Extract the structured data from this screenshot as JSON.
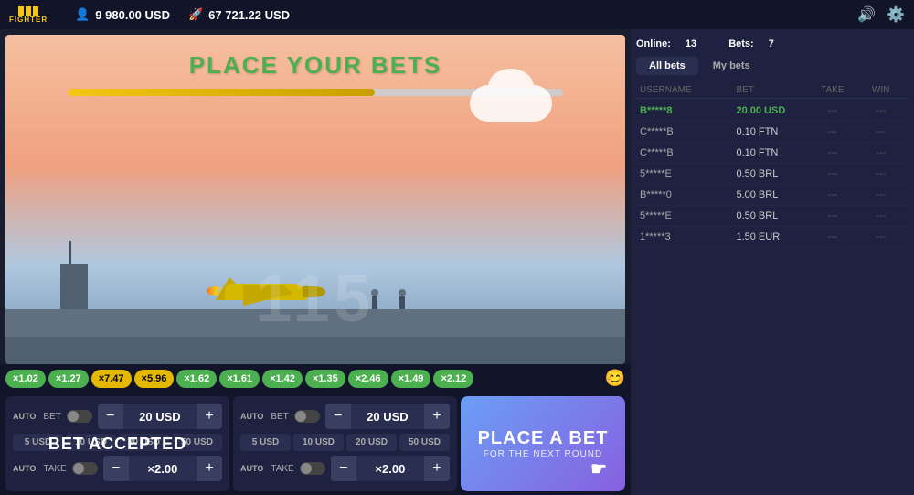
{
  "header": {
    "logo_bars": "///",
    "logo_text": "FIGHTER",
    "balance1_icon": "👤",
    "balance1": "9 980.00 USD",
    "balance2_icon": "🚀",
    "balance2": "67 721.22 USD",
    "icon_sound": "🔊",
    "icon_settings": "⚙️"
  },
  "game": {
    "title": "PLACE YOUR BETS",
    "progress_pct": 62,
    "round_number": "115"
  },
  "multipliers": [
    {
      "label": "×1.02",
      "color": "green"
    },
    {
      "label": "×1.27",
      "color": "green"
    },
    {
      "label": "×7.47",
      "color": "yellow"
    },
    {
      "label": "×5.96",
      "color": "yellow"
    },
    {
      "label": "×1.62",
      "color": "green"
    },
    {
      "label": "×1.61",
      "color": "green"
    },
    {
      "label": "×1.42",
      "color": "green"
    },
    {
      "label": "×1.35",
      "color": "green"
    },
    {
      "label": "×2.46",
      "color": "green"
    },
    {
      "label": "×1.49",
      "color": "green"
    },
    {
      "label": "×2.12",
      "color": "green"
    }
  ],
  "bet_panel_left": {
    "auto_label": "AUTO",
    "bet_label": "BET",
    "amount": "20 USD",
    "minus": "−",
    "plus": "+",
    "quick": [
      "5 USD",
      "10 USD",
      "20 USD",
      "50 USD"
    ],
    "take_label": "TAKE",
    "take_value": "×2.00",
    "status": "BET ACCEPTED"
  },
  "bet_panel_right": {
    "auto_label": "AUTO",
    "bet_label": "BET",
    "amount": "20 USD",
    "minus": "−",
    "plus": "+",
    "quick": [
      "5 USD",
      "10 USD",
      "20 USD",
      "50 USD"
    ],
    "take_label": "TAKE",
    "take_value": "×2.00"
  },
  "place_bet_btn": {
    "main": "PLACE A BET",
    "sub": "FOR THE NEXT ROUND"
  },
  "bets_panel": {
    "online_label": "Online:",
    "online_count": "13",
    "bets_label": "Bets:",
    "bets_count": "7",
    "tab_all": "All bets",
    "tab_my": "My bets",
    "columns": [
      "USERNAME",
      "BET",
      "TAKE",
      "WIN"
    ],
    "rows": [
      {
        "user": "B*****8",
        "bet": "20.00 USD",
        "take": "---",
        "win": "---",
        "highlight": true
      },
      {
        "user": "C*****B",
        "bet": "0.10 FTN",
        "take": "---",
        "win": "---",
        "highlight": false
      },
      {
        "user": "C*****B",
        "bet": "0.10 FTN",
        "take": "---",
        "win": "---",
        "highlight": false
      },
      {
        "user": "5*****E",
        "bet": "0.50 BRL",
        "take": "---",
        "win": "---",
        "highlight": false
      },
      {
        "user": "B*****0",
        "bet": "5.00 BRL",
        "take": "---",
        "win": "---",
        "highlight": false
      },
      {
        "user": "5*****E",
        "bet": "0.50 BRL",
        "take": "---",
        "win": "---",
        "highlight": false
      },
      {
        "user": "1*****3",
        "bet": "1.50 EUR",
        "take": "---",
        "win": "---",
        "highlight": false
      }
    ]
  }
}
